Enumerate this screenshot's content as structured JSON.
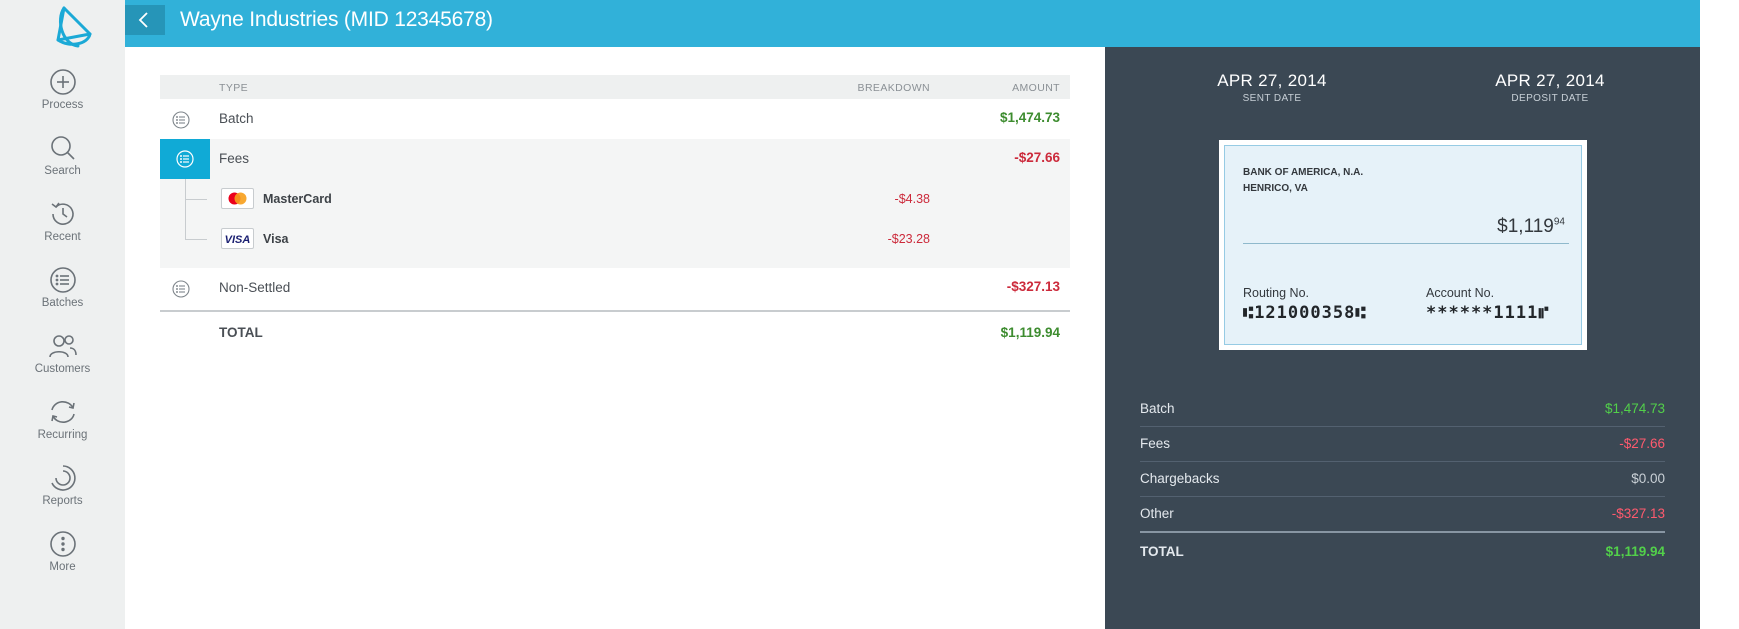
{
  "header": {
    "title": "Wayne Industries (MID 12345678)"
  },
  "nav": {
    "items": [
      {
        "label": "Process"
      },
      {
        "label": "Search"
      },
      {
        "label": "Recent"
      },
      {
        "label": "Batches"
      },
      {
        "label": "Customers"
      },
      {
        "label": "Recurring"
      },
      {
        "label": "Reports"
      },
      {
        "label": "More"
      }
    ]
  },
  "table": {
    "columns": {
      "type": "TYPE",
      "breakdown": "BREAKDOWN",
      "amount": "AMOUNT"
    },
    "batch": {
      "label": "Batch",
      "amount": "$1,474.73"
    },
    "fees": {
      "label": "Fees",
      "amount": "-$27.66",
      "items": [
        {
          "card": "MasterCard",
          "amount": "-$4.38",
          "icon": "mastercard-icon"
        },
        {
          "card": "Visa",
          "amount": "-$23.28",
          "icon": "visa-icon"
        }
      ]
    },
    "non_settled": {
      "label": "Non-Settled",
      "amount": "-$327.13"
    },
    "total": {
      "label": "TOTAL",
      "amount": "$1,119.94"
    }
  },
  "deposit": {
    "sent_date": "APR 27, 2014",
    "sent_label": "SENT DATE",
    "deposit_date": "APR 27, 2014",
    "deposit_label": "DEPOSIT DATE",
    "check": {
      "bank_name": "BANK OF AMERICA, N.A.",
      "bank_location": "HENRICO, VA",
      "amount_main": "$1,119",
      "amount_cents": "94",
      "routing_label": "Routing No.",
      "routing_value": "⑆121000358⑆",
      "account_label": "Account No.",
      "account_value": "******1111⑈"
    },
    "summary": [
      {
        "label": "Batch",
        "value": "$1,474.73",
        "tone": "positive"
      },
      {
        "label": "Fees",
        "value": "-$27.66",
        "tone": "negative"
      },
      {
        "label": "Chargebacks",
        "value": "$0.00",
        "tone": "neutral"
      },
      {
        "label": "Other",
        "value": "-$327.13",
        "tone": "negative"
      }
    ],
    "total_label": "TOTAL",
    "total_value": "$1,119.94"
  },
  "colors": {
    "header": "#31b1d9",
    "accent": "#10aad6",
    "positive": "#3d8c2f",
    "negative": "#cc2a3b",
    "panel": "#3b4854"
  }
}
